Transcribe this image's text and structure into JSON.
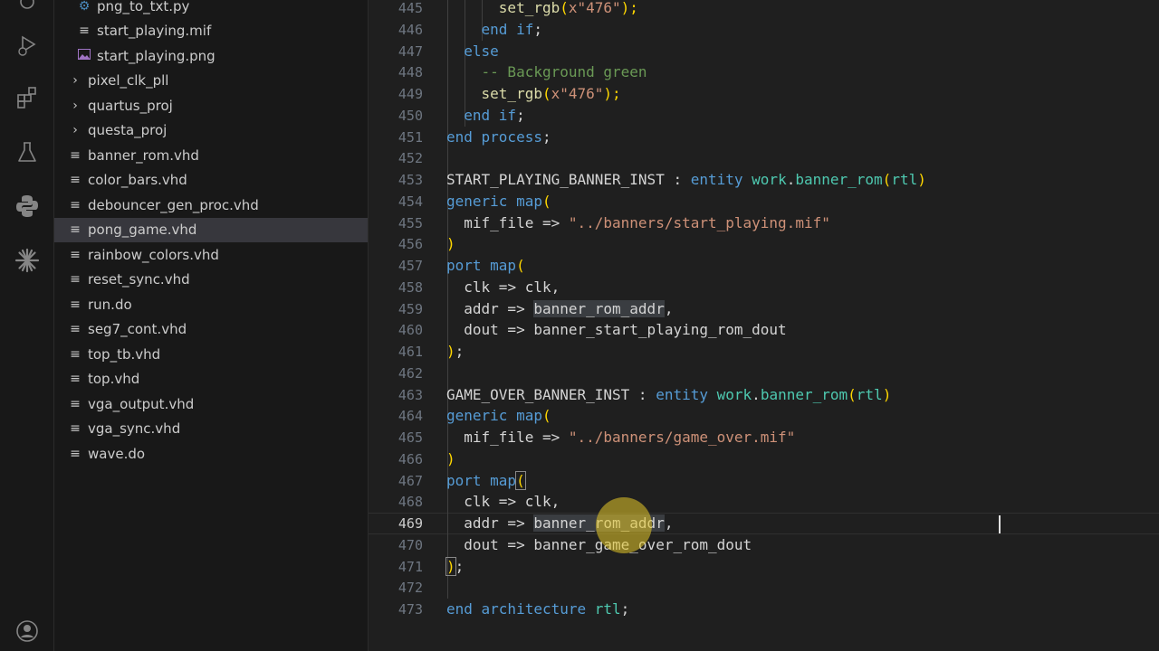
{
  "activity_bar": {
    "icons": [
      "settings-sync-icon",
      "run-debug-icon",
      "extensions-icon",
      "testing-icon",
      "python-icon",
      "sparkle-icon",
      "account-icon"
    ]
  },
  "explorer": {
    "items": [
      {
        "label": "png_to_txt.py",
        "kind": "python-file"
      },
      {
        "label": "start_playing.mif",
        "kind": "file"
      },
      {
        "label": "start_playing.png",
        "kind": "image-file"
      },
      {
        "label": "pixel_clk_pll",
        "kind": "folder"
      },
      {
        "label": "quartus_proj",
        "kind": "folder"
      },
      {
        "label": "questa_proj",
        "kind": "folder"
      },
      {
        "label": "banner_rom.vhd",
        "kind": "file"
      },
      {
        "label": "color_bars.vhd",
        "kind": "file"
      },
      {
        "label": "debouncer_gen_proc.vhd",
        "kind": "file"
      },
      {
        "label": "pong_game.vhd",
        "kind": "file",
        "selected": true
      },
      {
        "label": "rainbow_colors.vhd",
        "kind": "file"
      },
      {
        "label": "reset_sync.vhd",
        "kind": "file"
      },
      {
        "label": "run.do",
        "kind": "file"
      },
      {
        "label": "seg7_cont.vhd",
        "kind": "file"
      },
      {
        "label": "top_tb.vhd",
        "kind": "file"
      },
      {
        "label": "top.vhd",
        "kind": "file"
      },
      {
        "label": "vga_output.vhd",
        "kind": "file"
      },
      {
        "label": "vga_sync.vhd",
        "kind": "file"
      },
      {
        "label": "wave.do",
        "kind": "file"
      }
    ]
  },
  "editor": {
    "active_line": 469,
    "line_numbers": [
      "445",
      "446",
      "447",
      "448",
      "449",
      "450",
      "451",
      "452",
      "453",
      "454",
      "455",
      "456",
      "457",
      "458",
      "459",
      "460",
      "461",
      "462",
      "463",
      "464",
      "465",
      "466",
      "467",
      "468",
      "469",
      "470",
      "471",
      "472",
      "473"
    ],
    "code": {
      "l445": {
        "a": "      set_rgb",
        "b": "(",
        "c": "x\"476\"",
        "d": ");"
      },
      "l446": {
        "a": "    end if",
        "b": ";"
      },
      "l447": {
        "a": "  else"
      },
      "l448": {
        "a": "    -- Background green"
      },
      "l449": {
        "a": "    set_rgb",
        "b": "(",
        "c": "x\"476\"",
        "d": ");"
      },
      "l450": {
        "a": "  end if",
        "b": ";"
      },
      "l451": {
        "a": "end process",
        "b": ";"
      },
      "l453": {
        "a": "START_PLAYING_BANNER_INST",
        "b": " : ",
        "c": "entity",
        "d": " work",
        "e": ".",
        "f": "banner_rom",
        "g": "(",
        "h": "rtl",
        "i": ")"
      },
      "l454": {
        "a": "generic map",
        "b": "("
      },
      "l455": {
        "a": "  mif_file",
        "b": " => ",
        "c": "\"../banners/start_playing.mif\""
      },
      "l456": {
        "a": ")"
      },
      "l457": {
        "a": "port map",
        "b": "("
      },
      "l458": {
        "a": "  clk",
        "b": " => ",
        "c": "clk",
        "d": ","
      },
      "l459": {
        "a": "  addr",
        "b": " => ",
        "c": "banner_rom_addr",
        "d": ","
      },
      "l460": {
        "a": "  dout",
        "b": " => ",
        "c": "banner_start_playing_rom_dout"
      },
      "l461": {
        "a": ")",
        "b": ";"
      },
      "l463": {
        "a": "GAME_OVER_BANNER_INST",
        "b": " : ",
        "c": "entity",
        "d": " work",
        "e": ".",
        "f": "banner_rom",
        "g": "(",
        "h": "rtl",
        "i": ")"
      },
      "l464": {
        "a": "generic map",
        "b": "("
      },
      "l465": {
        "a": "  mif_file",
        "b": " => ",
        "c": "\"../banners/game_over.mif\""
      },
      "l466": {
        "a": ")"
      },
      "l467": {
        "a": "port map",
        "b": "("
      },
      "l468": {
        "a": "  clk",
        "b": " => ",
        "c": "clk",
        "d": ","
      },
      "l469": {
        "a": "  addr",
        "b": " => ",
        "c": "banner_rom_addr",
        "d": ","
      },
      "l470": {
        "a": "  dout",
        "b": " => ",
        "c": "banner_game_over_rom_dout"
      },
      "l471": {
        "a": ")",
        "b": ";"
      },
      "l473": {
        "a": "end architecture",
        "b": " rtl",
        "c": ";"
      }
    }
  }
}
